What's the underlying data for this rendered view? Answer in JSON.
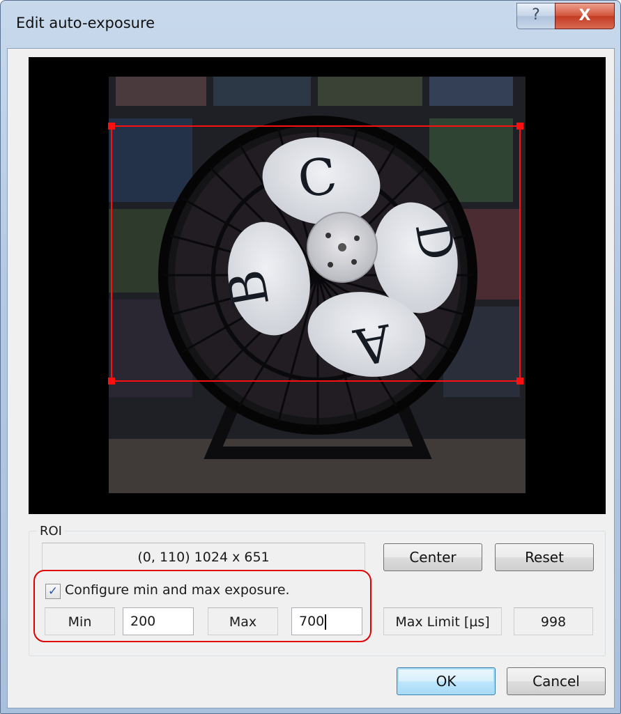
{
  "window": {
    "title": "Edit auto-exposure",
    "help_glyph": "?",
    "close_glyph": "X"
  },
  "preview": {
    "fan_letters": [
      "C",
      "D",
      "A",
      "B"
    ]
  },
  "roi": {
    "group_label": "ROI",
    "value": "(0, 110) 1024 x 651",
    "center_label": "Center",
    "reset_label": "Reset"
  },
  "exposure": {
    "checkbox_label": "Configure min and max exposure.",
    "checked": true,
    "min_label": "Min",
    "min_value": "200",
    "max_label": "Max",
    "max_value": "700",
    "max_limit_label": "Max Limit [µs]",
    "max_limit_value": "998"
  },
  "footer": {
    "ok_label": "OK",
    "cancel_label": "Cancel"
  },
  "colors": {
    "roi_frame": "#ff1010",
    "highlight": "#e00000"
  }
}
